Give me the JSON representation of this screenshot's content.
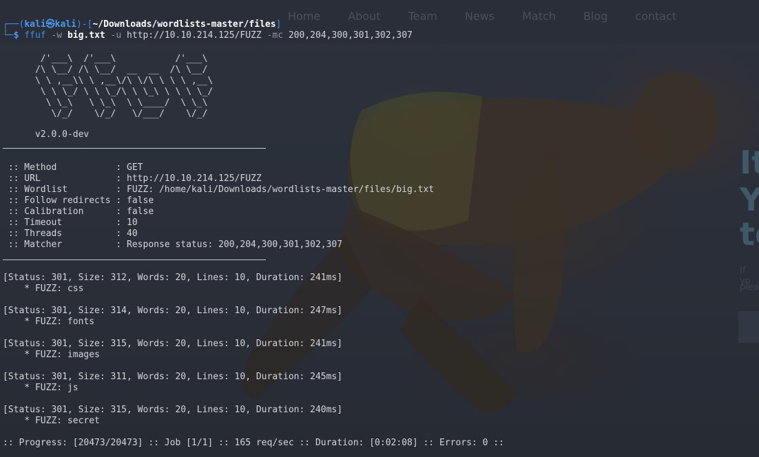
{
  "website": {
    "nav": [
      "Home",
      "About",
      "Team",
      "News",
      "Match",
      "Blog",
      "contact"
    ],
    "hero_lines": [
      "It",
      "Y",
      "to"
    ],
    "hero_sub_lines": [
      "If yo",
      "plea"
    ]
  },
  "terminal": {
    "prompt": {
      "corner_top": "┌──(",
      "user": "kali",
      "at": "㉿",
      "host": "kali",
      "mid": ")-[",
      "path": "~/Downloads/wordlists-master/files",
      "end": "]",
      "corner_bottom": "└─",
      "dollar": "$ "
    },
    "command": {
      "program": "ffuf",
      "flag_w": " -w ",
      "wordlist": "big.txt",
      "flag_u": " -u ",
      "url": "http://10.10.214.125/FUZZ",
      "flag_mc": " -mc ",
      "codes": "200,204,300,301,302,307"
    },
    "banner": "       /'___\\  /'___\\           /'___\\       \n      /\\ \\__/ /\\ \\__/  __  __  /\\ \\__/       \n      \\ \\ ,__\\\\ \\ ,__\\/\\ \\/\\ \\ \\ \\ ,__\\      \n       \\ \\ \\_/ \\ \\ \\_/\\ \\ \\_\\ \\ \\ \\ \\_/      \n        \\ \\_\\   \\ \\_\\  \\ \\____/  \\ \\_\\       \n         \\/_/    \\/_/   \\/___/    \\/_/       ",
    "version": "      v2.0.0-dev",
    "config": [
      {
        "key": " :: Method           : ",
        "value": "GET"
      },
      {
        "key": " :: URL              : ",
        "value": "http://10.10.214.125/FUZZ"
      },
      {
        "key": " :: Wordlist         : ",
        "value": "FUZZ: /home/kali/Downloads/wordlists-master/files/big.txt"
      },
      {
        "key": " :: Follow redirects : ",
        "value": "false"
      },
      {
        "key": " :: Calibration      : ",
        "value": "false"
      },
      {
        "key": " :: Timeout          : ",
        "value": "10"
      },
      {
        "key": " :: Threads          : ",
        "value": "40"
      },
      {
        "key": " :: Matcher          : ",
        "value": "Response status: 200,204,300,301,302,307"
      }
    ],
    "results": [
      {
        "status": "[Status: 301, Size: 312, Words: 20, Lines: 10, Duration: 241ms]",
        "fuzz": "    * FUZZ: css"
      },
      {
        "status": "[Status: 301, Size: 314, Words: 20, Lines: 10, Duration: 247ms]",
        "fuzz": "    * FUZZ: fonts"
      },
      {
        "status": "[Status: 301, Size: 315, Words: 20, Lines: 10, Duration: 241ms]",
        "fuzz": "    * FUZZ: images"
      },
      {
        "status": "[Status: 301, Size: 311, Words: 20, Lines: 10, Duration: 245ms]",
        "fuzz": "    * FUZZ: js"
      },
      {
        "status": "[Status: 301, Size: 315, Words: 20, Lines: 10, Duration: 240ms]",
        "fuzz": "    * FUZZ: secret"
      }
    ],
    "progress": ":: Progress: [20473/20473] :: Job [1/1] :: 165 req/sec :: Duration: [0:02:08] :: Errors: 0 ::"
  },
  "colors": {
    "prompt_blue": "#3b8eea",
    "text": "#d4d6da",
    "background": "#2a2f3a"
  }
}
